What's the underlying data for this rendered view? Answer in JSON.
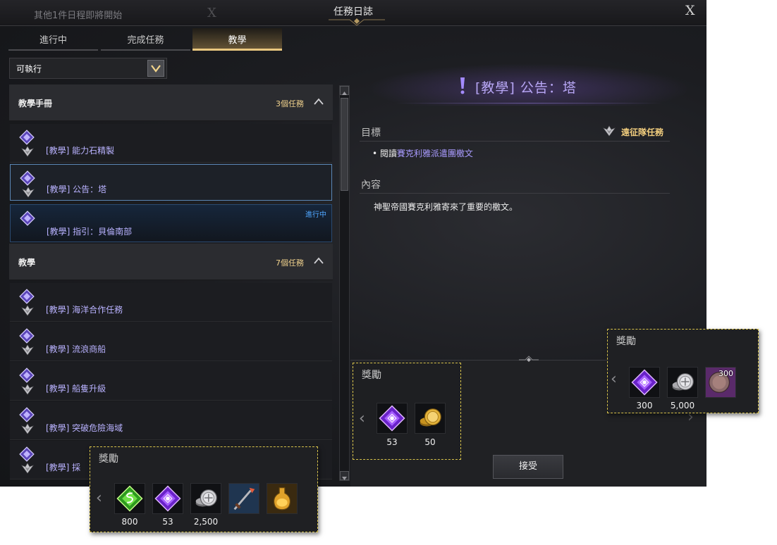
{
  "window": {
    "notice": "其他1件日程即將開始",
    "notice_close": "X",
    "title": "任務日誌",
    "close": "X"
  },
  "tabs": [
    {
      "label": "進行中",
      "active": false
    },
    {
      "label": "完成任務",
      "active": false
    },
    {
      "label": "教學",
      "active": true
    }
  ],
  "filter": {
    "selected": "可執行"
  },
  "quest_list": {
    "sections": [
      {
        "title": "教學手冊",
        "count": "3個任務",
        "items": [
          {
            "label": "[教學] 能力石精製",
            "status": ""
          },
          {
            "label": "[教學] 公告：塔",
            "status": "",
            "selected": true
          },
          {
            "label": "[教學] 指引：貝倫南部",
            "status": "進行中"
          }
        ]
      },
      {
        "title": "教學",
        "count": "7個任務",
        "items": [
          {
            "label": "[教學] 海洋合作任務"
          },
          {
            "label": "[教學] 流浪商船"
          },
          {
            "label": "[教學] 船隻升級"
          },
          {
            "label": "[教學] 突破危險海域"
          },
          {
            "label": "[教學] 採"
          }
        ]
      }
    ]
  },
  "detail": {
    "title": "[教學] 公告：塔",
    "goal_heading": "目標",
    "quest_type": "遠征隊任務",
    "goal_prefix": "閱讀",
    "goal_highlight": "賽克利雅派遣團檄文",
    "content_heading": "內容",
    "content_text": "神聖帝國賽克利雅寄來了重要的檄文。",
    "accept_label": "接受"
  },
  "rewards_main": {
    "title": "獎勵",
    "items": [
      {
        "icon": "purple-crystal-icon",
        "qty": "53"
      },
      {
        "icon": "gold-coin-icon",
        "qty": "50"
      }
    ]
  },
  "rewards_popup_right": {
    "title": "獎勵",
    "items": [
      {
        "icon": "purple-crystal-icon",
        "qty": "300"
      },
      {
        "icon": "silver-coin-icon",
        "qty": "5,000"
      },
      {
        "icon": "bronze-medal-icon",
        "qty": "",
        "badge": "300"
      }
    ]
  },
  "rewards_popup_left": {
    "title": "獎勵",
    "items": [
      {
        "icon": "green-gem-icon",
        "qty": "800"
      },
      {
        "icon": "purple-crystal-icon",
        "qty": "53"
      },
      {
        "icon": "silver-coin-icon",
        "qty": "2,500"
      },
      {
        "icon": "harpoon-icon",
        "qty": ""
      },
      {
        "icon": "potion-bottle-icon",
        "qty": ""
      }
    ]
  },
  "colors": {
    "accent_gold": "#e9c77f",
    "quest_link": "#b9b2ff",
    "in_progress": "#4fa6ff",
    "reward_border": "#d8c34b"
  }
}
